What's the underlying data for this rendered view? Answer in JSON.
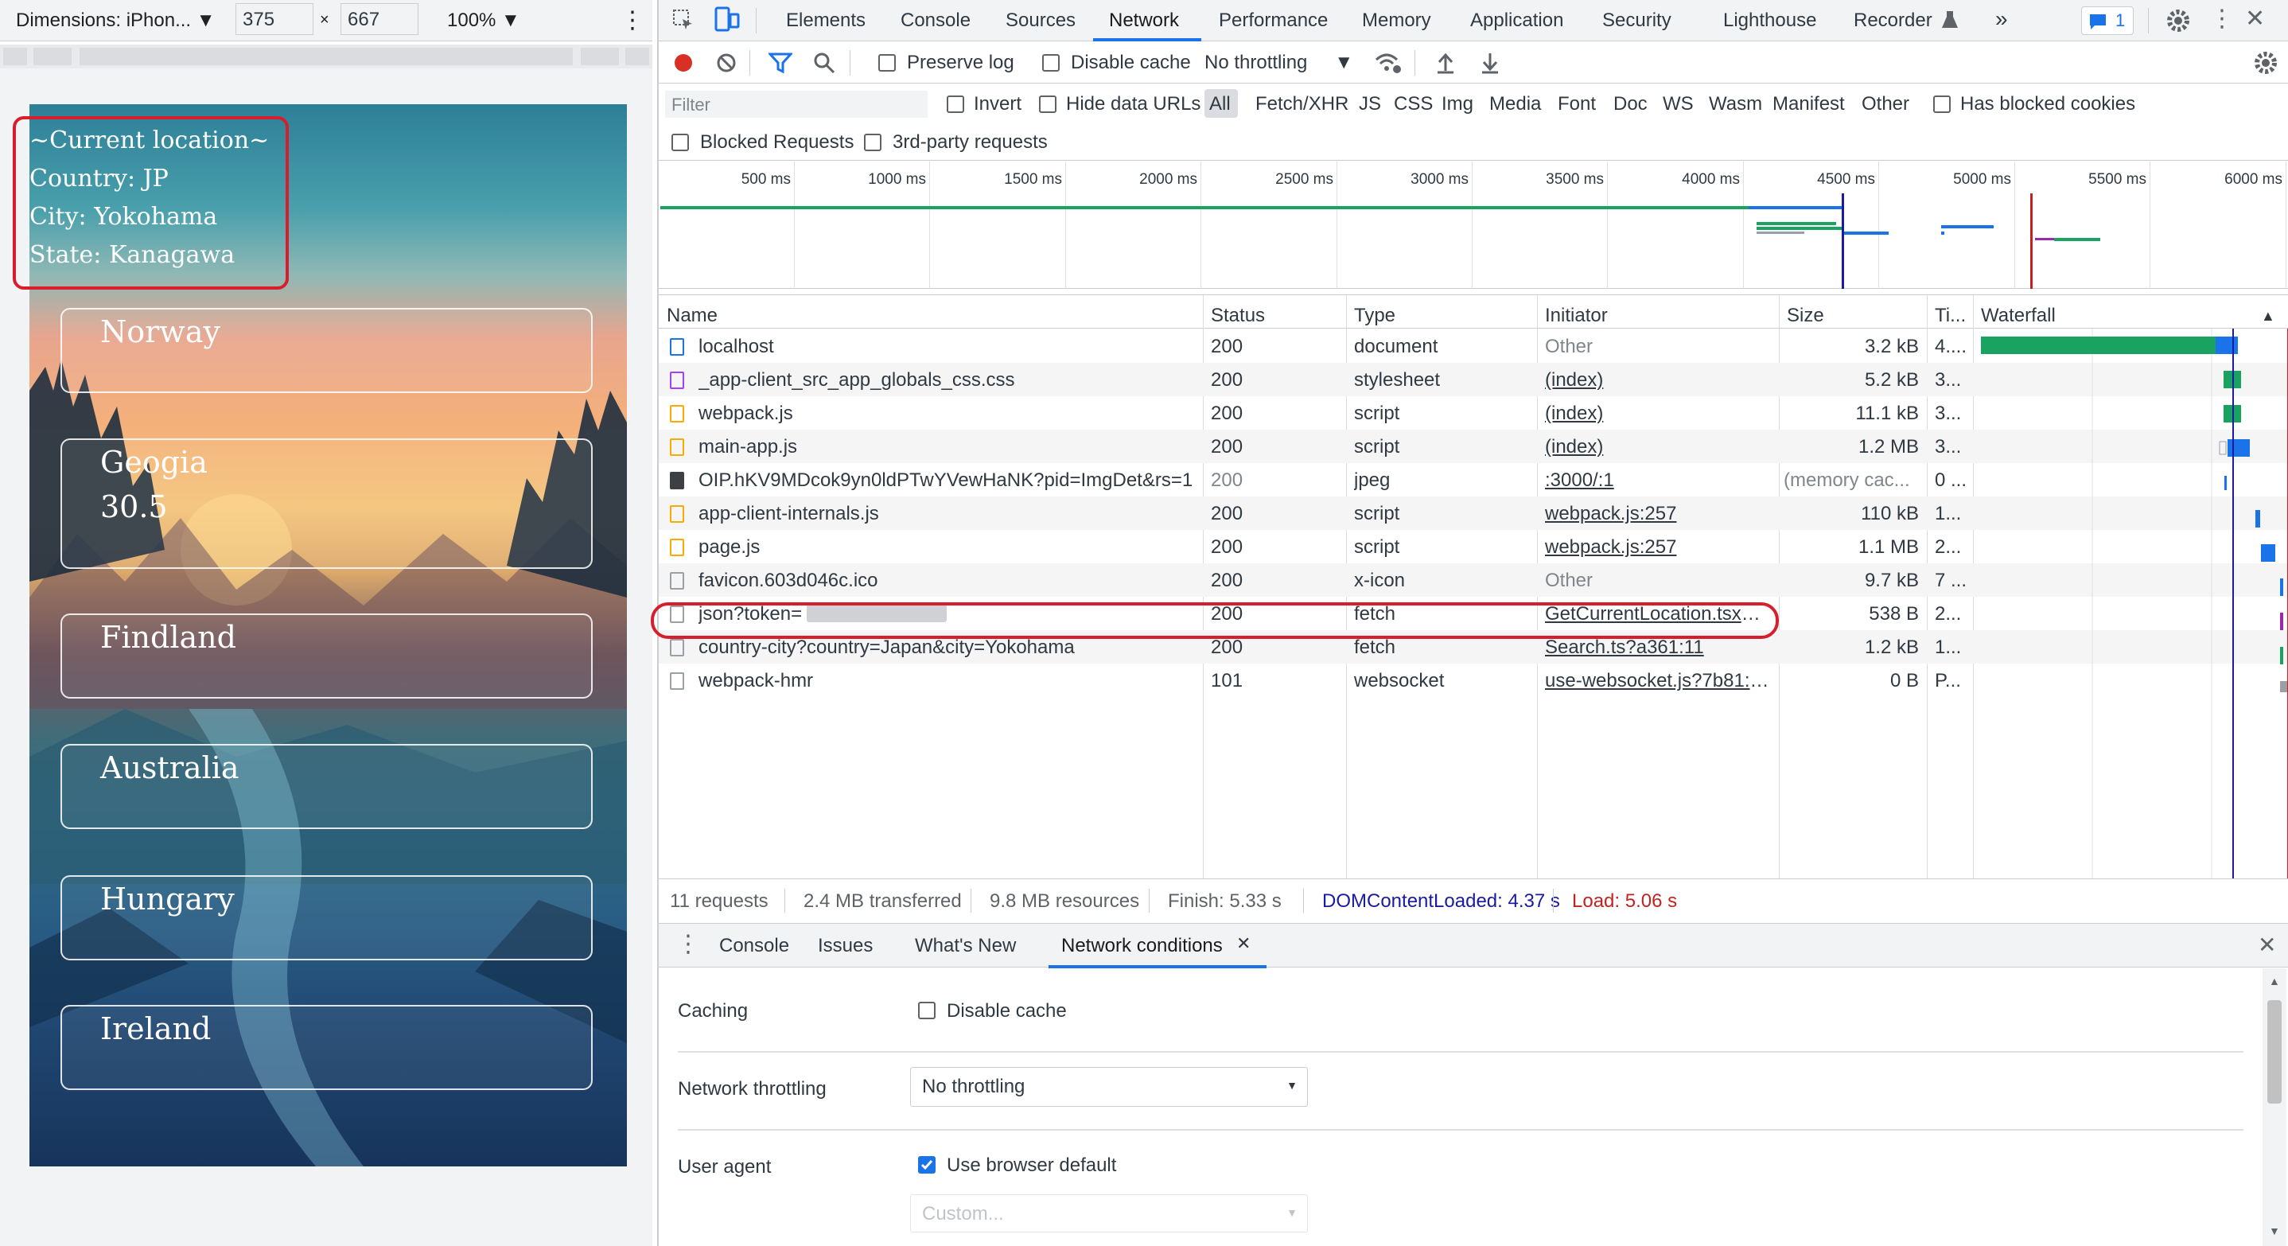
{
  "device_toolbar": {
    "dimensions_label": "Dimensions: iPhon...",
    "width": "375",
    "times": "×",
    "height": "667",
    "zoom": "100%"
  },
  "phone": {
    "location_title": "~Current location~",
    "country_line": "Country: JP",
    "city_line": "City: Yokohama",
    "state_line": "State: Kanagawa",
    "countries": [
      {
        "name": "Norway",
        "value": ""
      },
      {
        "name": "Geogia",
        "value": "30.5"
      },
      {
        "name": "Findland",
        "value": ""
      },
      {
        "name": "Australia",
        "value": ""
      },
      {
        "name": "Hungary",
        "value": ""
      },
      {
        "name": "Ireland",
        "value": ""
      }
    ]
  },
  "devtools": {
    "tabs": [
      "Elements",
      "Console",
      "Sources",
      "Network",
      "Performance",
      "Memory",
      "Application",
      "Security",
      "Lighthouse",
      "Recorder"
    ],
    "active_tab": "Network",
    "issues_count": "1",
    "more_tabs": "»"
  },
  "network_toolbar": {
    "preserve_log": "Preserve log",
    "disable_cache": "Disable cache",
    "throttling": "No throttling"
  },
  "filter_bar": {
    "placeholder": "Filter",
    "invert": "Invert",
    "hide_data_urls": "Hide data URLs",
    "types": [
      "All",
      "Fetch/XHR",
      "JS",
      "CSS",
      "Img",
      "Media",
      "Font",
      "Doc",
      "WS",
      "Wasm",
      "Manifest",
      "Other"
    ],
    "has_blocked_cookies": "Has blocked cookies",
    "blocked_requests": "Blocked Requests",
    "third_party": "3rd-party requests"
  },
  "overview": {
    "ticks": [
      "500 ms",
      "1000 ms",
      "1500 ms",
      "2000 ms",
      "2500 ms",
      "3000 ms",
      "3500 ms",
      "4000 ms",
      "4500 ms",
      "5000 ms",
      "5500 ms",
      "6000 ms"
    ]
  },
  "table": {
    "headers": {
      "name": "Name",
      "status": "Status",
      "type": "Type",
      "initiator": "Initiator",
      "size": "Size",
      "time": "Ti...",
      "waterfall": "Waterfall"
    },
    "rows": [
      {
        "name": "localhost",
        "status": "200",
        "type": "document",
        "initiator": "Other",
        "size": "3.2 kB",
        "time": "4....",
        "icon": "document-icon"
      },
      {
        "name": "_app-client_src_app_globals_css.css",
        "status": "200",
        "type": "stylesheet",
        "initiator": "(index)",
        "size": "5.2 kB",
        "time": "3...",
        "icon": "stylesheet-icon"
      },
      {
        "name": "webpack.js",
        "status": "200",
        "type": "script",
        "initiator": "(index)",
        "size": "11.1 kB",
        "time": "3...",
        "icon": "script-icon"
      },
      {
        "name": "main-app.js",
        "status": "200",
        "type": "script",
        "initiator": "(index)",
        "size": "1.2 MB",
        "time": "3...",
        "icon": "script-icon"
      },
      {
        "name": "OIP.hKV9MDcok9yn0ldPTwYVewHaNK?pid=ImgDet&rs=1",
        "status": "200",
        "type": "jpeg",
        "initiator": ":3000/:1",
        "size": "(memory cac...",
        "time": "0 ...",
        "icon": "image-icon"
      },
      {
        "name": "app-client-internals.js",
        "status": "200",
        "type": "script",
        "initiator": "webpack.js:257",
        "size": "110 kB",
        "time": "1...",
        "icon": "script-icon"
      },
      {
        "name": "page.js",
        "status": "200",
        "type": "script",
        "initiator": "webpack.js:257",
        "size": "1.1 MB",
        "time": "2...",
        "icon": "script-icon"
      },
      {
        "name": "favicon.603d046c.ico",
        "status": "200",
        "type": "x-icon",
        "initiator": "Other",
        "size": "9.7 kB",
        "time": "7 ...",
        "icon": "file-icon"
      },
      {
        "name": "json?token=",
        "status": "200",
        "type": "fetch",
        "initiator": "GetCurrentLocation.tsx?e...",
        "size": "538 B",
        "time": "2...",
        "icon": "file-icon"
      },
      {
        "name": "country-city?country=Japan&city=Yokohama",
        "status": "200",
        "type": "fetch",
        "initiator": "Search.ts?a361:11",
        "size": "1.2 kB",
        "time": "1...",
        "icon": "file-icon"
      },
      {
        "name": "webpack-hmr",
        "status": "101",
        "type": "websocket",
        "initiator": "use-websocket.js?7b81:24",
        "size": "0 B",
        "time": "P...",
        "icon": "file-icon"
      }
    ]
  },
  "summary": {
    "requests": "11 requests",
    "transferred": "2.4 MB transferred",
    "resources": "9.8 MB resources",
    "finish": "Finish: 5.33 s",
    "dom_content_loaded": "DOMContentLoaded: 4.37 s",
    "load": "Load: 5.06 s"
  },
  "drawer": {
    "tabs": [
      "Console",
      "Issues",
      "What's New",
      "Network conditions"
    ],
    "active_tab": "Network conditions",
    "caching_label": "Caching",
    "disable_cache": "Disable cache",
    "throttling_label": "Network throttling",
    "throttling_value": "No throttling",
    "user_agent_label": "User agent",
    "use_browser_default": "Use browser default",
    "custom_placeholder": "Custom..."
  },
  "colors": {
    "accent": "#1a73e8",
    "record_red": "#d93025",
    "highlight_red": "#d81e2c",
    "dcl_blue": "#1a1aa6",
    "load_red": "#c5221f"
  }
}
